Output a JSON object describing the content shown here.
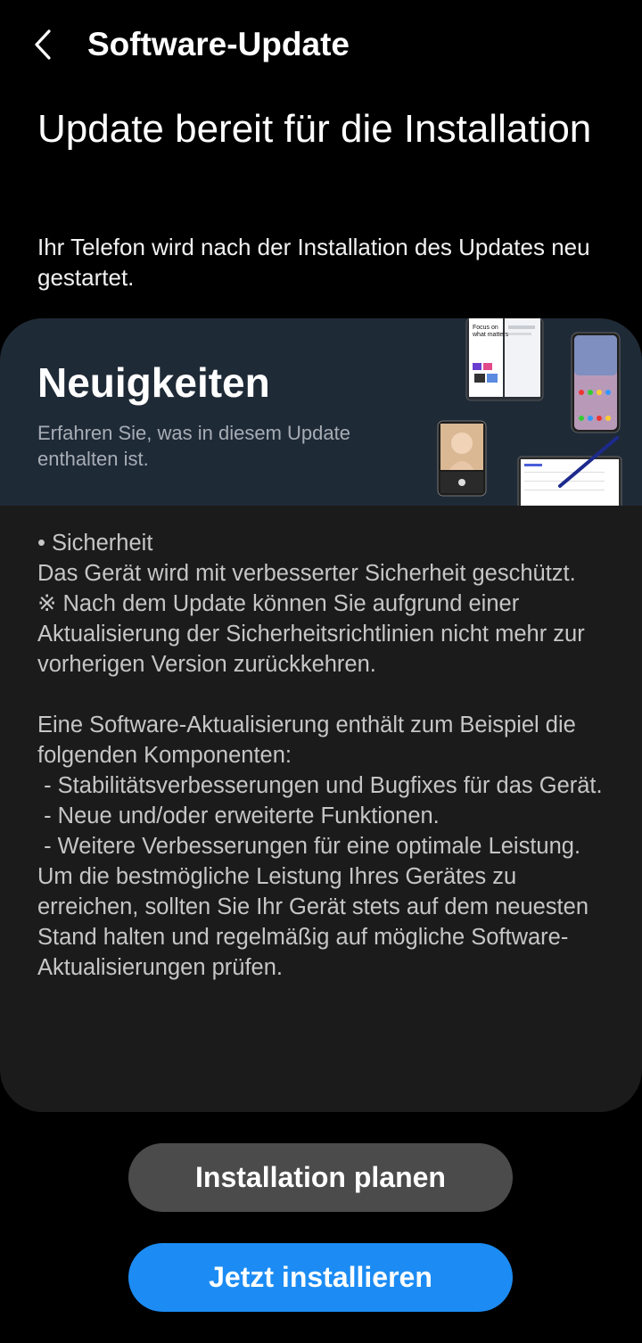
{
  "header": {
    "back_icon": "chevron-left-icon",
    "title": "Software-Update"
  },
  "main": {
    "headline": "Update bereit für die Installation",
    "subtext": "Ihr Telefon wird nach der Installation des Updates neu gestartet."
  },
  "news_card": {
    "title": "Neuigkeiten",
    "subtitle": "Erfahren Sie, was in diesem Update enthalten ist.",
    "banner_color": "#1f2a37",
    "art_text": [
      "Focus on",
      "what matters"
    ],
    "changelog": [
      "• Sicherheit",
      "Das Gerät wird mit verbesserter Sicherheit geschützt.",
      "※ Nach dem Update können Sie aufgrund einer Aktualisierung der Sicherheitsrichtlinien nicht mehr zur vorherigen Version zurückkehren.",
      "",
      "Eine Software-Aktualisierung enthält zum Beispiel die folgenden Komponenten:",
      " - Stabilitätsverbesserungen und Bugfixes für das Gerät.",
      " - Neue und/oder erweiterte Funktionen.",
      " - Weitere Verbesserungen für eine optimale Leistung.",
      "Um die bestmögliche Leistung Ihres Gerätes zu erreichen, sollten Sie Ihr Gerät stets auf dem neuesten Stand halten und regelmäßig auf mögliche Software-Aktualisierungen prüfen."
    ]
  },
  "actions": {
    "schedule_label": "Installation planen",
    "install_label": "Jetzt installieren",
    "install_color": "#1c8cf4"
  }
}
